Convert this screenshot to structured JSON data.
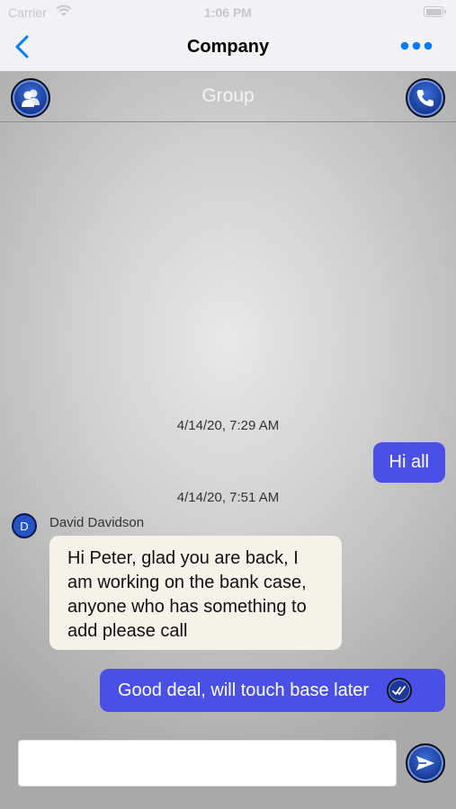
{
  "status_bar": {
    "carrier": "Carrier",
    "time": "1:06 PM"
  },
  "nav": {
    "title": "Company",
    "back_icon": "chevron-left-icon",
    "more_icon": "more-dots-icon"
  },
  "group_bar": {
    "title": "Group",
    "left_icon": "contacts-icon",
    "right_icon": "phone-icon"
  },
  "messages": [
    {
      "timestamp": "4/14/20, 7:29 AM"
    },
    {
      "direction": "outgoing",
      "text": "Hi all"
    },
    {
      "timestamp": "4/14/20, 7:51 AM"
    },
    {
      "direction": "incoming",
      "sender": "David Davidson",
      "avatar_initial": "D",
      "lines": [
        "Hi Peter,  glad you are back, I",
        "am working on the bank case,",
        "anyone who has something to",
        "add please call"
      ]
    },
    {
      "direction": "outgoing",
      "text": "Good deal, will touch base later",
      "status_icon": "read-check-icon"
    }
  ],
  "composer": {
    "value": "",
    "placeholder": "",
    "send_icon": "send-icon"
  },
  "colors": {
    "accent": "#007aff",
    "outgoing_bubble": "#4a4fe6",
    "incoming_bubble": "#f5f2ea",
    "button_blue": "#1c3f9c"
  }
}
